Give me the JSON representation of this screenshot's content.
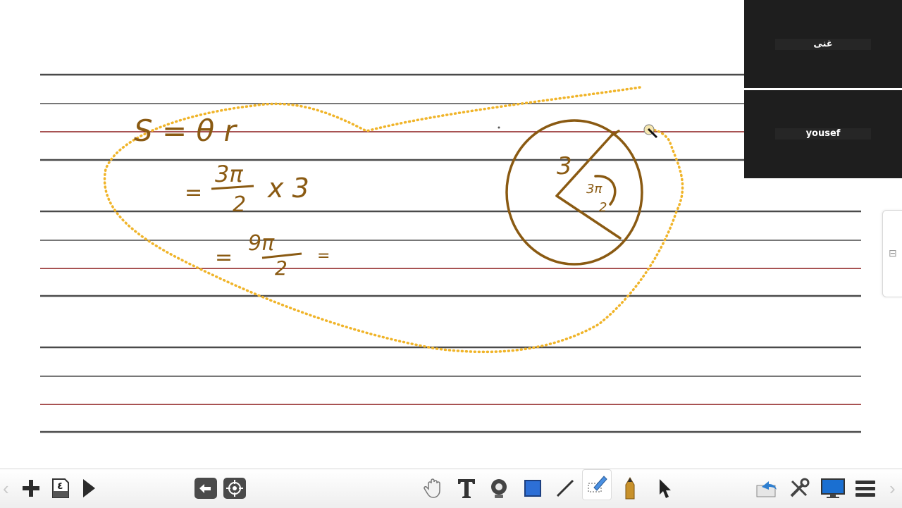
{
  "participants": [
    {
      "name": "غنى"
    },
    {
      "name": "yousef"
    }
  ],
  "board": {
    "lines": {
      "dark": "#4a4a4a",
      "red": "#8b1a1a"
    },
    "ink_color": "#8a5a12",
    "highlight_color": "#f0b429",
    "handwriting": {
      "line1": "S = θ r",
      "line2_num": "3π",
      "line2_den": "2",
      "line2_rest": "x 3",
      "line3_num": "9π",
      "line3_den": "2",
      "circle_radius_label": "3",
      "angle_label_num": "3π",
      "angle_label_den": "2"
    }
  },
  "toolbar": {
    "left": [
      "add-page-icon",
      "page-icon",
      "next-icon"
    ],
    "page_number": "٤",
    "middle": [
      "undo-icon",
      "locate-icon"
    ],
    "tools": [
      "hand-icon",
      "text-icon",
      "stamp-icon",
      "rectangle-icon",
      "line-icon",
      "highlighter-icon",
      "pencil-icon",
      "pointer-icon"
    ],
    "right": [
      "share-icon",
      "tools-icon",
      "screen-icon",
      "menu-icon"
    ]
  }
}
